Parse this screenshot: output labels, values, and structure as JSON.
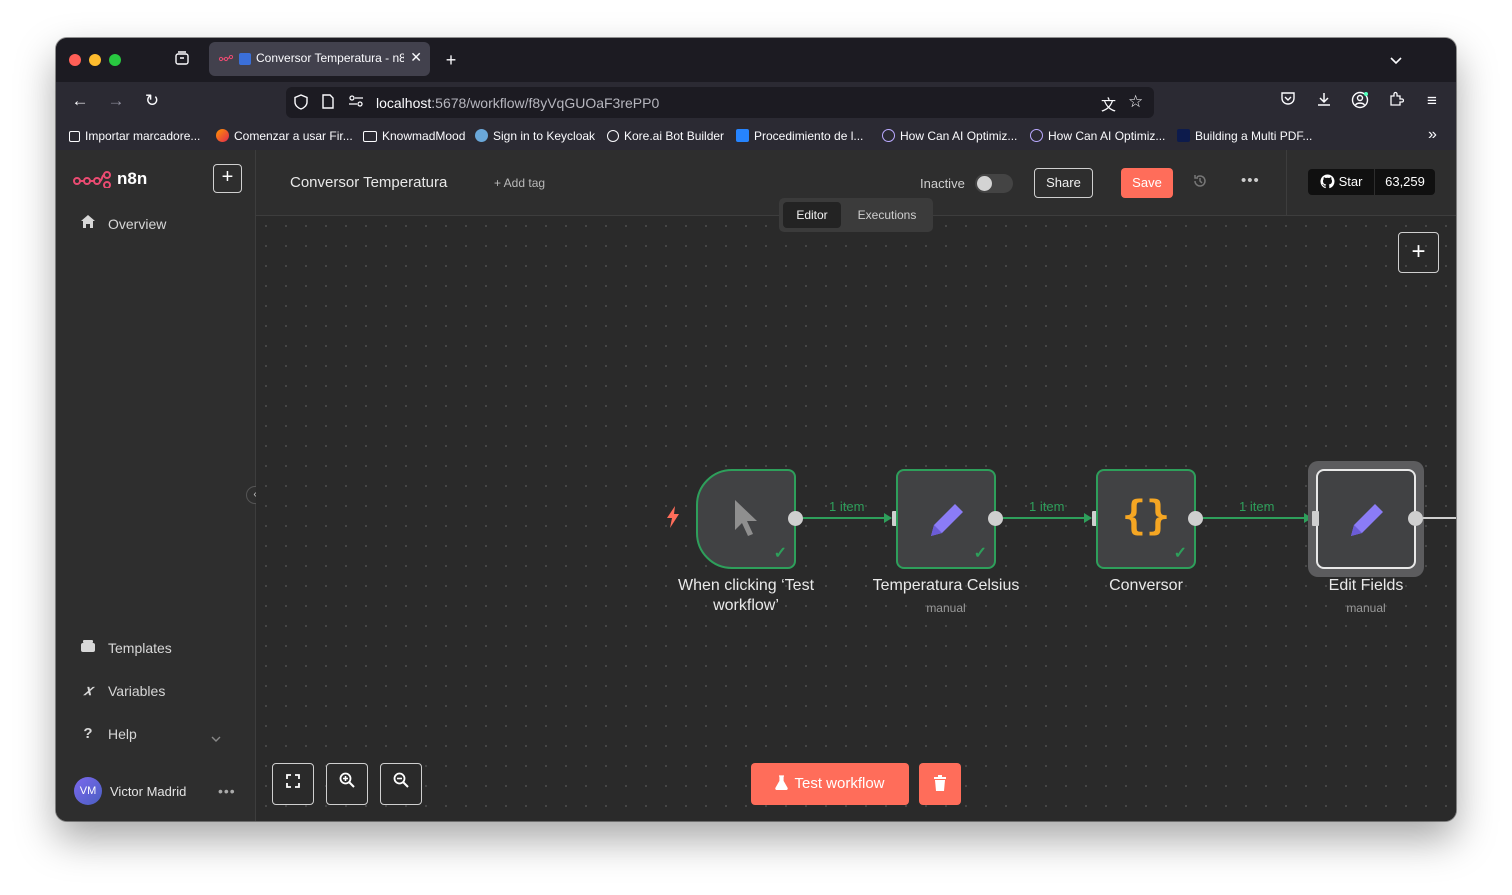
{
  "browser": {
    "tab_title": "Conversor Temperatura - n8n",
    "url_host": "localhost",
    "url_path": ":5678/workflow/f8yVqGUOaF3rePP0",
    "bookmarks": [
      "Importar marcadore...",
      "Comenzar a usar Fir...",
      "KnowmadMood",
      "Sign in to Keycloak",
      "Kore.ai Bot Builder",
      "Procedimiento de l...",
      "How Can AI Optimiz...",
      "How Can AI Optimiz...",
      "Building a Multi PDF..."
    ]
  },
  "sidebar": {
    "logo_text": "n8n",
    "overview": "Overview",
    "templates": "Templates",
    "variables": "Variables",
    "help": "Help",
    "user_initials": "VM",
    "user_name": "Victor Madrid"
  },
  "header": {
    "workflow_title": "Conversor Temperatura",
    "add_tag": "+ Add tag",
    "status_label": "Inactive",
    "share": "Share",
    "save": "Save",
    "github_star": "Star",
    "github_count": "63,259"
  },
  "mode": {
    "editor": "Editor",
    "executions": "Executions"
  },
  "workflow": {
    "nodes": [
      {
        "label": "When clicking ‘Test workflow’",
        "sub": ""
      },
      {
        "label": "Temperatura Celsius",
        "sub": "manual"
      },
      {
        "label": "Conversor",
        "sub": ""
      },
      {
        "label": "Edit Fields",
        "sub": "manual"
      }
    ],
    "edges": [
      "1 item",
      "1 item",
      "1 item"
    ],
    "colors": {
      "success": "#2e9f5b",
      "accent": "#ff6d5a",
      "edit_icon": "#8b7cf6",
      "code_icon": "#f5a623"
    }
  },
  "canvas_controls": {
    "test_workflow": "Test workflow"
  }
}
